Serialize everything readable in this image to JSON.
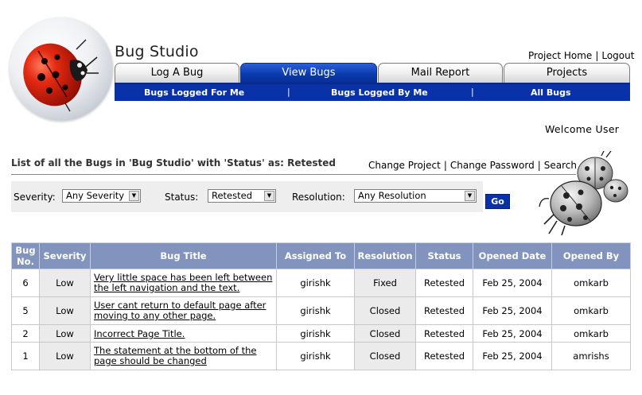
{
  "app": {
    "title": "Bug Studio"
  },
  "top_links": [
    {
      "label": "Project Home"
    },
    {
      "label": "Logout"
    }
  ],
  "tabs": [
    {
      "label": "Log A Bug",
      "active": false
    },
    {
      "label": "View Bugs",
      "active": true
    },
    {
      "label": "Mail Report",
      "active": false
    },
    {
      "label": "Projects",
      "active": false
    }
  ],
  "subnav": [
    {
      "label": "Bugs Logged For Me"
    },
    {
      "label": "Bugs Logged By Me"
    },
    {
      "label": "All Bugs"
    }
  ],
  "welcome": "Welcome User",
  "list_heading": "List of all the Bugs in 'Bug Studio' with 'Status' as: Retested",
  "secondary_links": [
    {
      "label": "Change Project"
    },
    {
      "label": "Change Password"
    },
    {
      "label": "Search"
    }
  ],
  "filters": {
    "severity": {
      "label": "Severity:",
      "value": "Any Severity"
    },
    "status": {
      "label": "Status:",
      "value": "Retested"
    },
    "resolution": {
      "label": "Resolution:",
      "value": "Any Resolution"
    },
    "go_label": "Go"
  },
  "table": {
    "columns": [
      "Bug No.",
      "Severity",
      "Bug Title",
      "Assigned To",
      "Resolution",
      "Status",
      "Opened Date",
      "Opened By"
    ],
    "rows": [
      {
        "no": "6",
        "severity": "Low",
        "title": "Very little space has been left between the left navigation and the text.",
        "assigned": "girishk",
        "resolution": "Fixed",
        "status": "Retested",
        "opened_date": "Feb 25, 2004",
        "opened_by": "omkarb"
      },
      {
        "no": "5",
        "severity": "Low",
        "title": "User cant return to default page after moving to any other page.",
        "assigned": "girishk",
        "resolution": "Closed",
        "status": "Retested",
        "opened_date": "Feb 25, 2004",
        "opened_by": "omkarb"
      },
      {
        "no": "2",
        "severity": "Low",
        "title": "Incorrect Page Title.",
        "assigned": "girishk",
        "resolution": "Closed",
        "status": "Retested",
        "opened_date": "Feb 25, 2004",
        "opened_by": "omkarb"
      },
      {
        "no": "1",
        "severity": "Low",
        "title": "The statement at the bottom of the page should be changed",
        "assigned": "girishk",
        "resolution": "Closed",
        "status": "Retested",
        "opened_date": "Feb 25, 2004",
        "opened_by": "amrishs"
      }
    ]
  },
  "colors": {
    "accent": "#0a32a8",
    "table_header": "#8294bd",
    "ladybug_red": "#d4160a"
  }
}
